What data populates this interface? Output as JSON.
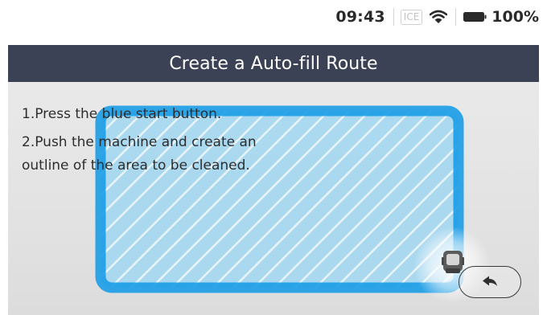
{
  "status": {
    "time": "09:43",
    "carrier_badge": "ICE",
    "wifi_icon": "wifi-icon",
    "battery_icon": "battery-icon",
    "battery_percent": "100%"
  },
  "header": {
    "title": "Create a Auto-fill Route"
  },
  "instructions": {
    "step1": "1.Press the blue start button.",
    "step2": "2.Push the machine and create an outline of the area to be cleaned."
  },
  "actions": {
    "back_icon": "undo-arrow-icon"
  },
  "colors": {
    "header_bg": "#3b4255",
    "route_outline": "#1e9ee6",
    "route_fill": "#9ad2ee"
  }
}
